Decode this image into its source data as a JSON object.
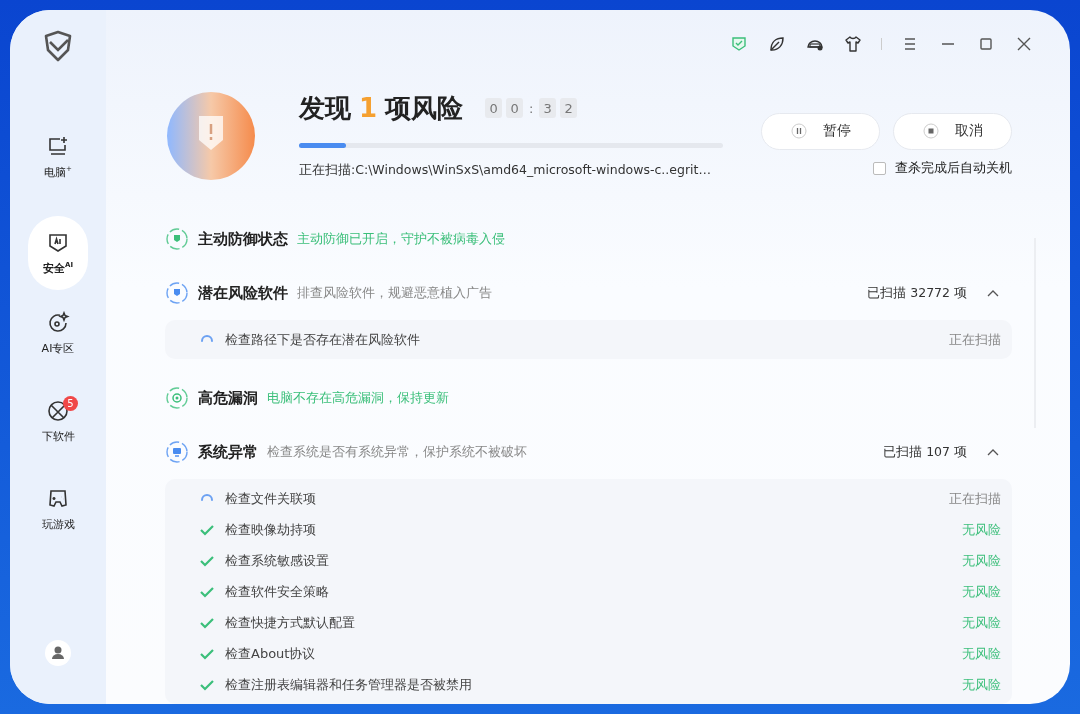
{
  "sidebar": {
    "items": [
      {
        "label": "电脑$^{+}$",
        "selected": false
      },
      {
        "label": "安全$^{AI}$",
        "selected": true
      },
      {
        "label": "AI专区",
        "selected": false
      },
      {
        "label": "下软件",
        "selected": false,
        "badge": "5"
      },
      {
        "label": "玩游戏",
        "selected": false
      }
    ]
  },
  "header": {
    "title_prefix": "发现",
    "count": "1",
    "title_suffix": "项风险",
    "timer": [
      "0",
      "0",
      ":",
      "3",
      "2"
    ],
    "progress": {
      "level": 0.11
    },
    "scan_path": "正在扫描:C:\\Windows\\WinSxS\\amd64_microsoft-windows-c..egrit…",
    "buttons": [
      {
        "label": "暂停",
        "kind": "pause"
      },
      {
        "label": "取消",
        "kind": "stop"
      }
    ],
    "auto_shutdown": {
      "label": "查杀完成后自动关机",
      "checked": false
    }
  },
  "sections": [
    {
      "title": "主动防御状态",
      "desc": "主动防御已开启，守护不被病毒入侵",
      "kind": "safe"
    },
    {
      "title": "潜在风险软件",
      "desc": "排查风险软件，规避恶意植入广告",
      "kind": "scanning",
      "count": "已扫描 32772 项",
      "expanded": true,
      "items": [
        {
          "label": "检查路径下是否存在潜在风险软件",
          "kind": "scanning",
          "result": "正在扫描"
        }
      ]
    },
    {
      "title": "高危漏洞",
      "desc": "电脑不存在高危漏洞，保持更新",
      "kind": "safe"
    },
    {
      "title": "系统异常",
      "desc": "检查系统是否有系统异常，保护系统不被破坏",
      "kind": "scanning",
      "count": "已扫描 107 项",
      "expanded": true,
      "items": [
        {
          "label": "检查文件关联项",
          "kind": "scanning",
          "result": "正在扫描"
        },
        {
          "label": "检查映像劫持项",
          "kind": "safe",
          "result": "无风险"
        },
        {
          "label": "检查系统敏感设置",
          "kind": "safe",
          "result": "无风险"
        },
        {
          "label": "检查软件安全策略",
          "kind": "safe",
          "result": "无风险"
        },
        {
          "label": "检查快捷方式默认配置",
          "kind": "safe",
          "result": "无风险"
        },
        {
          "label": "检查About协议",
          "kind": "safe",
          "result": "无风险"
        },
        {
          "label": "检查注册表编辑器和任务管理器是否被禁用",
          "kind": "safe",
          "result": "无风险"
        }
      ]
    }
  ]
}
